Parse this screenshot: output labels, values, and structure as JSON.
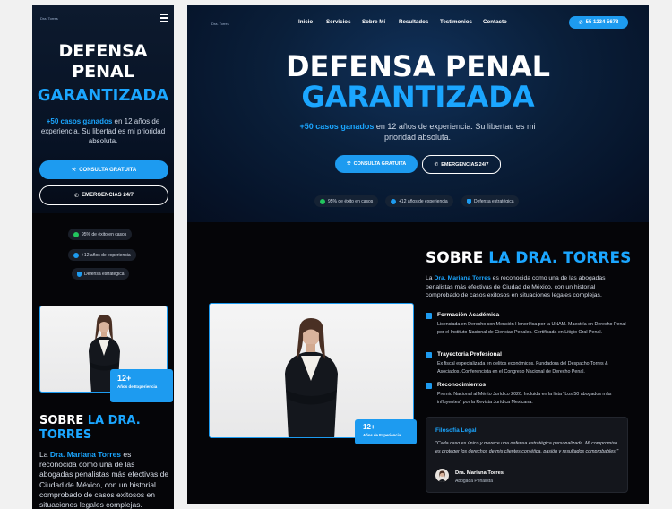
{
  "brand": {
    "logo_text": "Dra. Torres",
    "accent": "#1d9bf0",
    "dark_bg": "#050508"
  },
  "nav": {
    "items": [
      "Inicio",
      "Servicios",
      "Sobre Mí",
      "Resultados",
      "Testimonios",
      "Contacto"
    ],
    "phone": "55 1234 5678"
  },
  "hero": {
    "title_line1": "DEFENSA PENAL",
    "title_mobile_line1": "DEFENSA",
    "title_mobile_line2": "PENAL",
    "title_highlight": "GARANTIZADA",
    "subtitle_highlight": "+50 casos ganados",
    "subtitle_rest": " en 12 años de experiencia. Su libertad es mi prioridad absoluta.",
    "cta_primary": "CONSULTA GRATUITA",
    "cta_secondary": "EMERGENCIAS 24/7",
    "stats": [
      "95% de éxito en casos",
      "+12 años de experiencia",
      "Defensa estratégica"
    ]
  },
  "about": {
    "heading_plain": "SOBRE ",
    "heading_highlight": "LA DRA. TORRES",
    "heading_mobile_highlight_1": "LA DRA.",
    "heading_mobile_highlight_2": "TORRES",
    "intro_prefix": "La ",
    "intro_name": "Dra. Mariana Torres",
    "intro_rest": " es reconocida como una de las abogadas penalistas más efectivas de Ciudad de México, con un historial comprobado de casos exitosos en situaciones legales complejas.",
    "badge_number": "12+",
    "badge_label": "Años de Experiencia",
    "items": [
      {
        "title": "Formación Académica",
        "text": "Licenciada en Derecho con Mención Honorífica por la UNAM. Maestría en Derecho Penal por el Instituto Nacional de Ciencias Penales. Certificada en Litigio Oral Penal."
      },
      {
        "title": "Trayectoria Profesional",
        "text": "Ex fiscal especializada en delitos económicos. Fundadora del Despacho Torres & Asociados. Conferencista en el Congreso Nacional de Derecho Penal."
      },
      {
        "title": "Reconocimientos",
        "text": "Premio Nacional al Mérito Jurídico 2020. Incluida en la lista \"Los 50 abogados más influyentes\" por la Revista Jurídica Mexicana."
      }
    ],
    "philosophy": {
      "title": "Filosofía Legal",
      "quote": "\"Cada caso es único y merece una defensa estratégica personalizada. Mi compromiso es proteger los derechos de mis clientes con ética, pasión y resultados comprobables.\"",
      "author": "Dra. Mariana Torres",
      "role": "Abogada Penalista"
    }
  }
}
